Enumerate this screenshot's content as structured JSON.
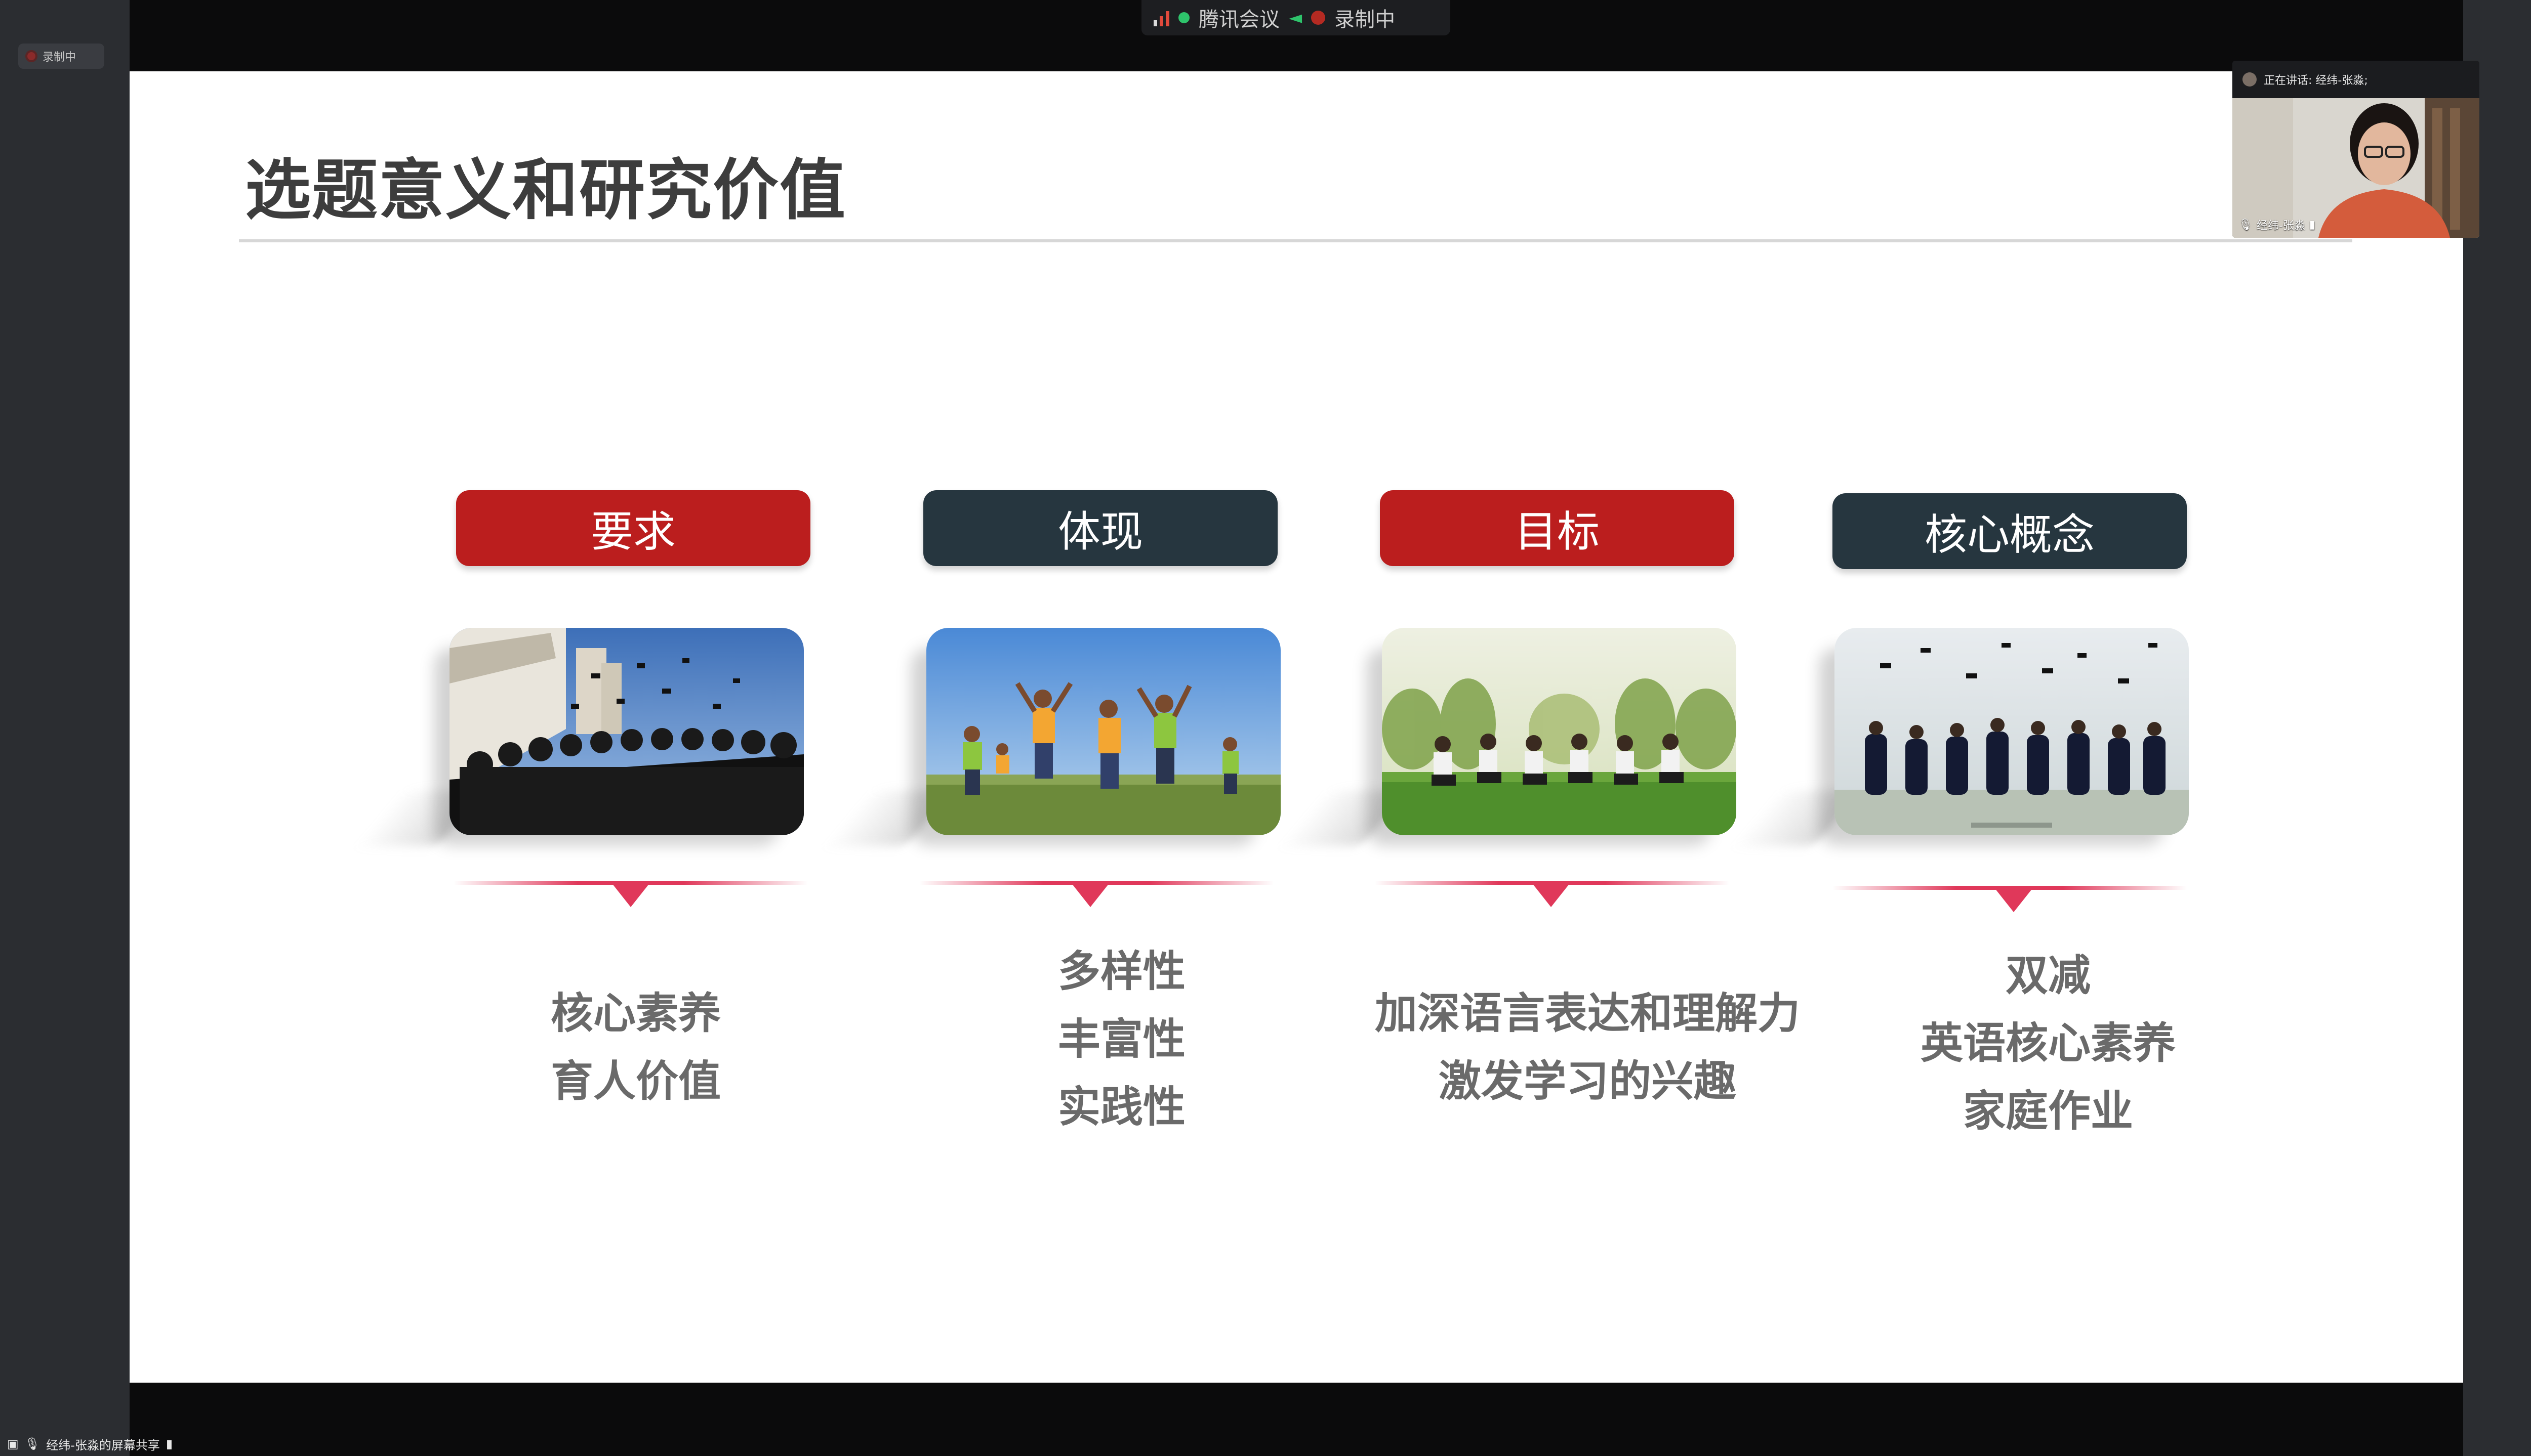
{
  "app": {
    "name": "腾讯会议",
    "recording_label": "录制中"
  },
  "sidebar": {
    "recording_chip": "录制中"
  },
  "slide": {
    "title": "选题意义和研究价值",
    "columns": [
      {
        "heading": "要求",
        "heading_color": "#bb1e1e",
        "lines": [
          "核心素养",
          "育人价值"
        ]
      },
      {
        "heading": "体现",
        "heading_color": "#26363f",
        "lines": [
          "多样性",
          "丰富性",
          "实践性"
        ]
      },
      {
        "heading": "目标",
        "heading_color": "#bb1e1e",
        "lines": [
          "加深语言表达和理解力",
          "激发学习的兴趣"
        ]
      },
      {
        "heading": "核心概念",
        "heading_color": "#26363f",
        "lines": [
          "双减",
          "英语核心素养",
          "家庭作业"
        ]
      }
    ]
  },
  "camera": {
    "speaking_label": "正在讲话: 经纬-张淼;",
    "participant_name": "经纬-张淼"
  },
  "status_bar": {
    "share_label": "经纬-张淼的屏幕共享"
  },
  "colors": {
    "accent_red": "#bb1e1e",
    "accent_dark": "#26363f",
    "marker_pink": "#e0385a",
    "recording_red": "#b42a22",
    "live_green": "#2ec36b"
  }
}
